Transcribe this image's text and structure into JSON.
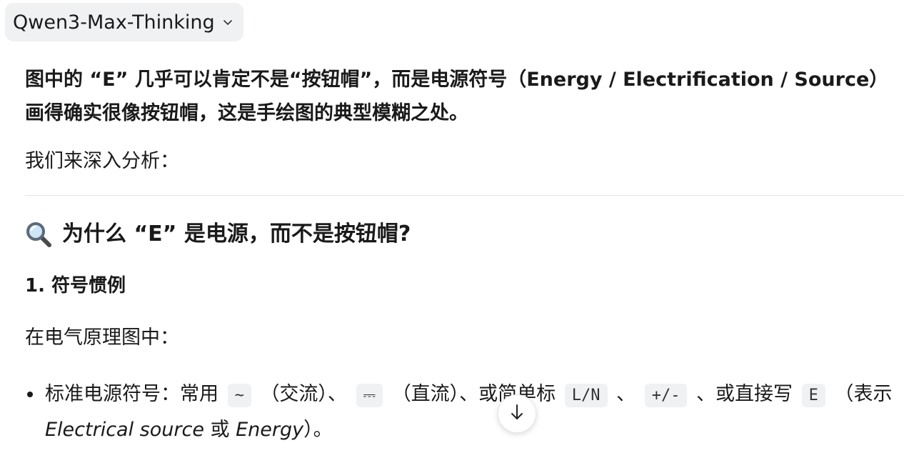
{
  "model_selector": {
    "label": "Qwen3-Max-Thinking",
    "icon": "chevron-down-icon"
  },
  "message": {
    "lead_line1": "图中的 “E” 几乎可以肯定不是“按钮帽”，而是电源符号（Energy / Electrification / Source）",
    "lead_line2": "画得确实很像按钮帽，这是手绘图的典型模糊之处。",
    "analysis_intro": "我们来深入分析：",
    "section_heading": "为什么 “E” 是电源，而不是按钮帽?",
    "section_icon": "magnifier-icon",
    "subheading": "1. 符号惯例",
    "circuit_intro": "在电气原理图中：",
    "bullet1": {
      "t1": "标准电源符号：常用",
      "code1": "~",
      "t2": "（交流）、",
      "code2": "⎓",
      "t3": "（直流）、或简单标",
      "code3": "L/N",
      "t4": "、",
      "code4": "+/-",
      "t5": "、或直接写",
      "code5": "E",
      "t6": "（表示",
      "it1": "Electrical source",
      "t7": "或",
      "it2": "Energy",
      "t8": "）。"
    }
  },
  "scroll_button": {
    "icon": "arrow-down-icon"
  }
}
